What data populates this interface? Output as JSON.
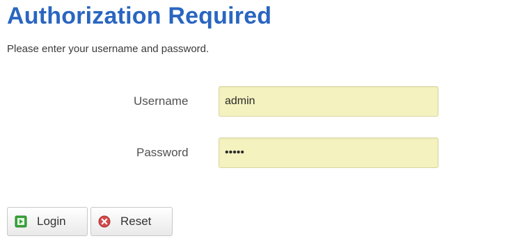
{
  "header": {
    "title": "Authorization Required",
    "subtitle": "Please enter your username and password."
  },
  "form": {
    "username_label": "Username",
    "username_value": "admin",
    "password_label": "Password",
    "password_value": "•••••"
  },
  "actions": {
    "login_label": "Login",
    "login_icon": "login-icon",
    "reset_label": "Reset",
    "reset_icon": "reset-icon"
  },
  "colors": {
    "title": "#2a66c0",
    "input_background": "#f4f2be",
    "login_icon": "#3aa63a",
    "reset_icon": "#d44a4a"
  }
}
